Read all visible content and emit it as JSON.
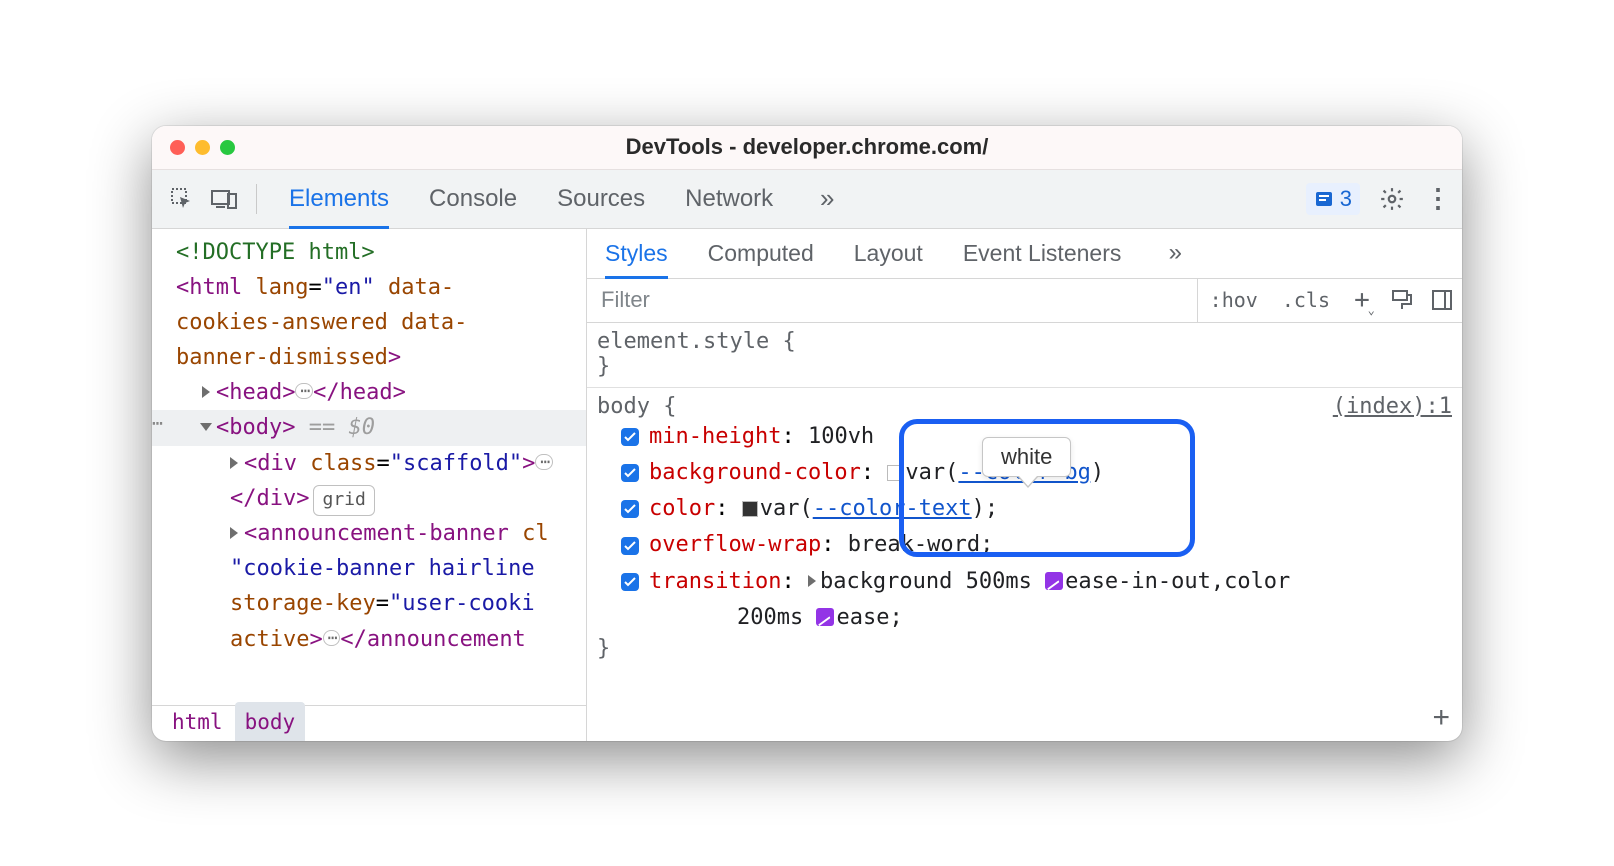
{
  "window_title": "DevTools - developer.chrome.com/",
  "issue_count": "3",
  "main_tabs": [
    "Elements",
    "Console",
    "Sources",
    "Network"
  ],
  "dom": {
    "doctype": "<!DOCTYPE html>",
    "html_open": "<html lang=\"en\" data-cookies-answered data-banner-dismissed>",
    "head": {
      "open": "<head>",
      "close": "</head>"
    },
    "body_open": "<body>",
    "body_sel_extra": "== $0",
    "scaffold_open": "<div class=\"scaffold\">",
    "scaffold_close": "</div>",
    "scaffold_badge": "grid",
    "banner": "<announcement-banner class=\"cookie-banner hairline\" storage-key=\"user-cookie\" active>",
    "banner_close": "</announcement-"
  },
  "breadcrumbs": [
    "html",
    "body"
  ],
  "side_tabs": [
    "Styles",
    "Computed",
    "Layout",
    "Event Listeners"
  ],
  "filter_placeholder": "Filter",
  "filter_btns": {
    "hov": ":hov",
    "cls": ".cls"
  },
  "element_style": {
    "selector": "element.style",
    "brace_open": "{",
    "brace_close": "}"
  },
  "body_rule": {
    "selector": "body",
    "source": "(index):1",
    "decls": [
      {
        "prop": "min-height",
        "val": "100vh"
      },
      {
        "prop": "background-color",
        "val_prefix": "var(",
        "var": "--color-bg",
        "val_suffix": ")"
      },
      {
        "prop": "color",
        "val_prefix": "var(",
        "var": "--color-text",
        "val_suffix": ");"
      },
      {
        "prop": "overflow-wrap",
        "val": "break-word;"
      },
      {
        "prop": "transition",
        "val_part1": "background 500ms",
        "ease1": "ease-in-out",
        "sep": ",color",
        "val_part2": "200ms",
        "ease2": "ease;"
      }
    ]
  },
  "tooltip": "white"
}
